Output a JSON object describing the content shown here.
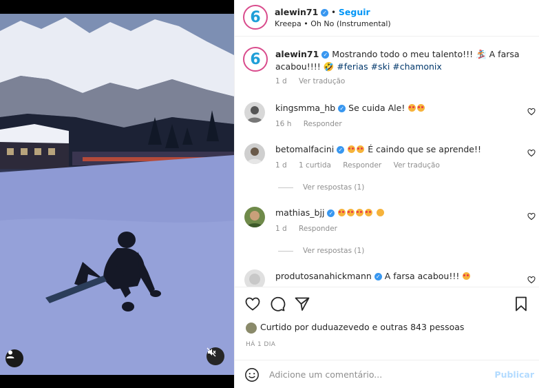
{
  "post": {
    "author": "alewin71",
    "follow_label": "Seguir",
    "audio": "Kreepa • Oh No (Instrumental)",
    "logo_text": "6"
  },
  "caption": {
    "author": "alewin71",
    "text": "Mostrando todo o meu talento!!! 🏂 A farsa acabou!!!! 🤣",
    "hashtags": "#ferias #ski #chamonix",
    "time": "1 d",
    "translate": "Ver tradução"
  },
  "comments": [
    {
      "user": "kingsmma_hb",
      "text": "Se cuida Ale!",
      "time": "16 h",
      "reply": "Responder"
    },
    {
      "user": "betomalfacini",
      "text": "É caindo que se aprende!!",
      "time": "1 d",
      "likes": "1 curtida",
      "reply": "Responder",
      "translate": "Ver tradução",
      "view_replies": "Ver respostas (1)"
    },
    {
      "user": "mathias_bjj",
      "text": "",
      "time": "1 d",
      "reply": "Responder",
      "view_replies": "Ver respostas (1)"
    },
    {
      "user": "produtosanahickmann",
      "text": "A farsa acabou!!!"
    }
  ],
  "actions": {
    "liked_by": "Curtido por duduazevedo e outras 843 pessoas",
    "date": "HÁ 1 DIA"
  },
  "composer": {
    "placeholder": "Adicione um comentário...",
    "publish_label": "Publicar"
  },
  "colors": {
    "accent": "#0095f6",
    "verified": "#3897f0",
    "meta": "#8e8e8e"
  }
}
